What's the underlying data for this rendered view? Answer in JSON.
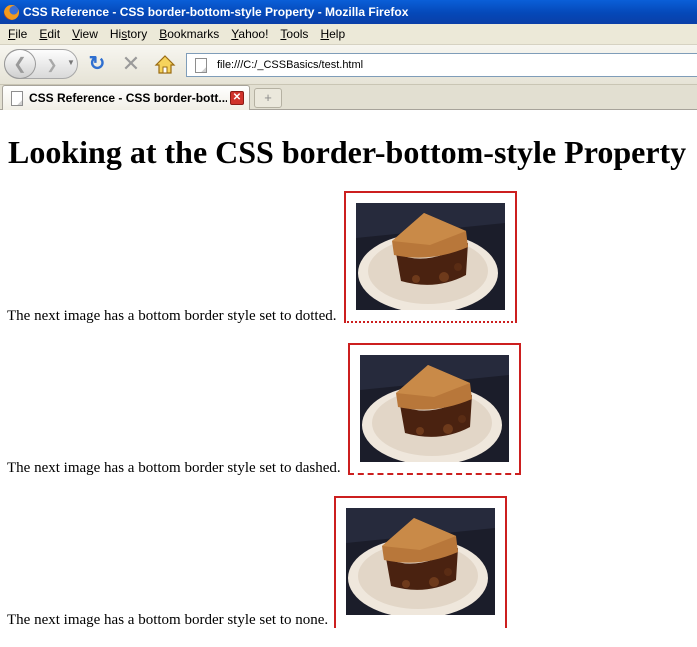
{
  "window": {
    "title": "CSS Reference - CSS border-bottom-style Property - Mozilla Firefox"
  },
  "menu": {
    "items": [
      {
        "pre": "",
        "key": "F",
        "post": "ile"
      },
      {
        "pre": "",
        "key": "E",
        "post": "dit"
      },
      {
        "pre": "",
        "key": "V",
        "post": "iew"
      },
      {
        "pre": "Hi",
        "key": "s",
        "post": "tory"
      },
      {
        "pre": "",
        "key": "B",
        "post": "ookmarks"
      },
      {
        "pre": "",
        "key": "Y",
        "post": "ahoo!"
      },
      {
        "pre": "",
        "key": "T",
        "post": "ools"
      },
      {
        "pre": "",
        "key": "H",
        "post": "elp"
      }
    ]
  },
  "toolbar": {
    "url": "file:///C:/_CSSBasics/test.html",
    "icons": [
      "back-icon",
      "forward-icon",
      "dropdown-icon",
      "reload-icon",
      "stop-icon",
      "home-icon",
      "page-icon"
    ]
  },
  "tabs": {
    "active_label": "CSS Reference - CSS border-bott...",
    "new_tab_symbol": "+"
  },
  "page": {
    "heading": "Looking at the CSS border-bottom-style Property",
    "paragraphs": [
      {
        "text": "The next image has a bottom border style set to dotted.",
        "border_style": "dotted"
      },
      {
        "text": "The next image has a bottom border style set to dashed.",
        "border_style": "dashed"
      },
      {
        "text": "The next image has a bottom border style set to none.",
        "border_style": "none"
      }
    ]
  },
  "colors": {
    "image_border": "#cc1f1f",
    "titlebar": "#0548b8",
    "chrome": "#ece9d8"
  }
}
